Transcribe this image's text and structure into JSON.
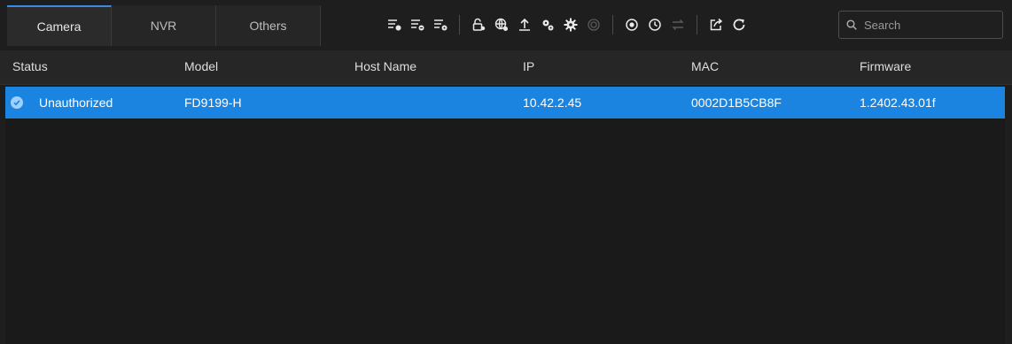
{
  "tabs": [
    {
      "label": "Camera",
      "active": true
    },
    {
      "label": "NVR",
      "active": false
    },
    {
      "label": "Others",
      "active": false
    }
  ],
  "toolbar": {
    "icons": [
      {
        "name": "list-add-icon",
        "enabled": true
      },
      {
        "name": "list-remove-icon",
        "enabled": true
      },
      {
        "name": "list-settings-icon",
        "enabled": true
      },
      {
        "name": "lock-icon",
        "enabled": true
      },
      {
        "name": "network-settings-icon",
        "enabled": true
      },
      {
        "name": "upload-icon",
        "enabled": true
      },
      {
        "name": "gears-icon",
        "enabled": true
      },
      {
        "name": "gear-icon",
        "enabled": true
      },
      {
        "name": "record-icon",
        "enabled": false
      },
      {
        "name": "target-icon",
        "enabled": true
      },
      {
        "name": "clock-icon",
        "enabled": true
      },
      {
        "name": "swap-icon",
        "enabled": false
      },
      {
        "name": "export-icon",
        "enabled": true
      },
      {
        "name": "refresh-icon",
        "enabled": true
      }
    ]
  },
  "search": {
    "placeholder": "Search"
  },
  "table": {
    "columns": [
      "Status",
      "Model",
      "Host Name",
      "IP",
      "MAC",
      "Firmware"
    ],
    "rows": [
      {
        "status": "Unauthorized",
        "model": "FD9199-H",
        "host_name": "",
        "ip": "10.42.2.45",
        "mac": "0002D1B5CB8F",
        "firmware": "1.2402.43.01f"
      }
    ]
  },
  "colors": {
    "accent": "#1b84e0",
    "background": "#1e1e1e",
    "header": "#262626"
  }
}
